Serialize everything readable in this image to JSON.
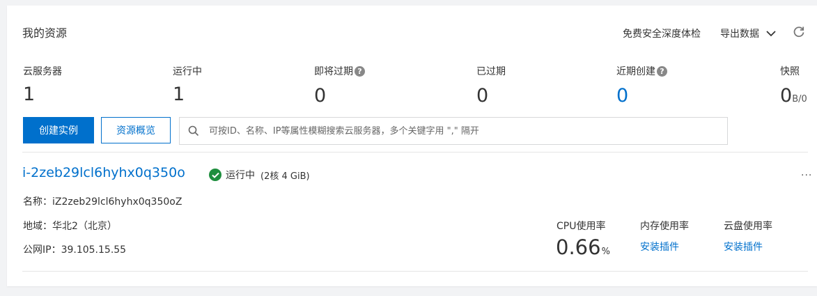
{
  "panel": {
    "title": "我的资源",
    "security_check": "免费安全深度体检",
    "export_label": "导出数据",
    "refresh_icon": "refresh-icon"
  },
  "stats": [
    {
      "label": "云服务器",
      "value": "1",
      "help": false
    },
    {
      "label": "运行中",
      "value": "1",
      "help": false
    },
    {
      "label": "即将过期",
      "value": "0",
      "help": true
    },
    {
      "label": "已过期",
      "value": "0",
      "help": false
    },
    {
      "label": "近期创建",
      "value": "0",
      "help": true
    },
    {
      "label": "快照",
      "value": "0",
      "unit": "B/0",
      "help": false
    }
  ],
  "actions": {
    "create_label": "创建实例",
    "overview_label": "资源概览",
    "search_placeholder": "可按ID、名称、IP等属性模糊搜索云服务器，多个关键字用 \",\" 隔开"
  },
  "instance": {
    "id": "i-2zeb29lcl6hyhx0q350o",
    "status": "运行中",
    "spec": "(2核 4 GiB)",
    "more": "...",
    "name_line": "名称：iZ2zeb29lcl6hyhx0q350oZ",
    "region_line": "地域：华北2（北京）",
    "ip_line": "公网IP：39.105.15.55"
  },
  "metrics": {
    "cpu_label": "CPU使用率",
    "cpu_value": "0.66",
    "cpu_unit": "%",
    "memory_label": "内存使用率",
    "memory_action": "安装插件",
    "disk_label": "云盘使用率",
    "disk_action": "安装插件"
  },
  "colors": {
    "primary": "#0070cc",
    "running": "#1e8e3e"
  }
}
